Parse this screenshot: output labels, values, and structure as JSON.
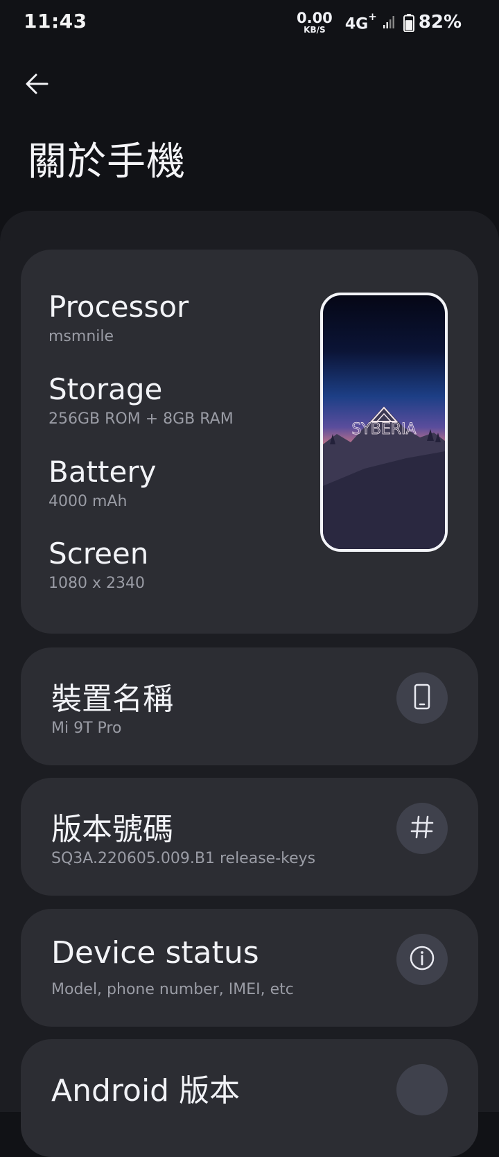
{
  "status_bar": {
    "time": "11:43",
    "net_speed_value": "0.00",
    "net_speed_unit": "KB/S",
    "network_type": "4G",
    "network_plus": "+",
    "battery_percent": "82%",
    "battery_level": 0.82
  },
  "header": {
    "title": "關於手機",
    "back_icon": "arrow-left-icon"
  },
  "specs": [
    {
      "label": "Processor",
      "value": "msmnile"
    },
    {
      "label": "Storage",
      "value": "256GB ROM + 8GB RAM"
    },
    {
      "label": "Battery",
      "value": "4000 mAh"
    },
    {
      "label": "Screen",
      "value": "1080 x 2340"
    }
  ],
  "phone_preview": {
    "wallpaper_text": "SYBERIA"
  },
  "items": [
    {
      "title": "裝置名稱",
      "subtitle": "Mi 9T Pro",
      "icon": "smartphone-icon"
    },
    {
      "title": "版本號碼",
      "subtitle": "SQ3A.220605.009.B1 release-keys",
      "icon": "hash-icon"
    },
    {
      "title": "Device status",
      "subtitle": "Model, phone number, IMEI, etc",
      "icon": "info-icon"
    },
    {
      "title": "Android 版本",
      "subtitle": "",
      "icon": "android-icon"
    }
  ],
  "colors": {
    "background": "#111216",
    "sheet": "#1c1d22",
    "card": "#2c2d33",
    "icon_circle": "#3f414c",
    "secondary_text": "#9a9ca5"
  }
}
